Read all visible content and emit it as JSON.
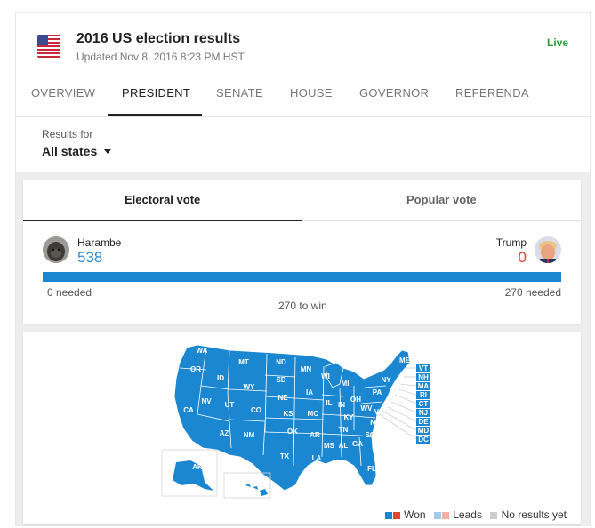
{
  "header": {
    "title": "2016 US election results",
    "updated": "Updated Nov 8, 2016 8:23 PM HST",
    "live": "Live"
  },
  "tabs": [
    {
      "label": "OVERVIEW",
      "active": false
    },
    {
      "label": "PRESIDENT",
      "active": true
    },
    {
      "label": "SENATE",
      "active": false
    },
    {
      "label": "HOUSE",
      "active": false
    },
    {
      "label": "GOVERNOR",
      "active": false
    },
    {
      "label": "REFERENDA",
      "active": false
    }
  ],
  "filter": {
    "label": "Results for",
    "value": "All states"
  },
  "vote_tabs": {
    "electoral": "Electoral vote",
    "popular": "Popular vote"
  },
  "candidates": {
    "left": {
      "name": "Harambe",
      "votes": "538",
      "needed": "0 needed",
      "color": "#2a8ad4"
    },
    "right": {
      "name": "Trump",
      "votes": "0",
      "needed": "270 needed",
      "color": "#e0452f"
    }
  },
  "progress": {
    "left_fraction": 1.0,
    "to_win": "270 to win"
  },
  "map": {
    "won_color": "#1b87d1",
    "states_labels": [
      "WA",
      "OR",
      "CA",
      "NV",
      "ID",
      "MT",
      "WY",
      "UT",
      "AZ",
      "CO",
      "NM",
      "ND",
      "SD",
      "NE",
      "KS",
      "OK",
      "TX",
      "MN",
      "IA",
      "MO",
      "AR",
      "LA",
      "WI",
      "IL",
      "MI",
      "IN",
      "OH",
      "KY",
      "TN",
      "MS",
      "AL",
      "GA",
      "FL",
      "SC",
      "NC",
      "VA",
      "WV",
      "PA",
      "NY",
      "ME",
      "AK",
      "HI"
    ],
    "small_states": [
      "VT",
      "NH",
      "MA",
      "RI",
      "CT",
      "NJ",
      "DE",
      "MD",
      "DC"
    ]
  },
  "legend": {
    "won": "Won",
    "leads": "Leads",
    "no_results": "No results yet",
    "colors": {
      "won_blue": "#1b87d1",
      "won_red": "#e0452f",
      "leads_blue": "#9fcbea",
      "leads_red": "#f2b0a4",
      "none": "#cccccc"
    }
  }
}
